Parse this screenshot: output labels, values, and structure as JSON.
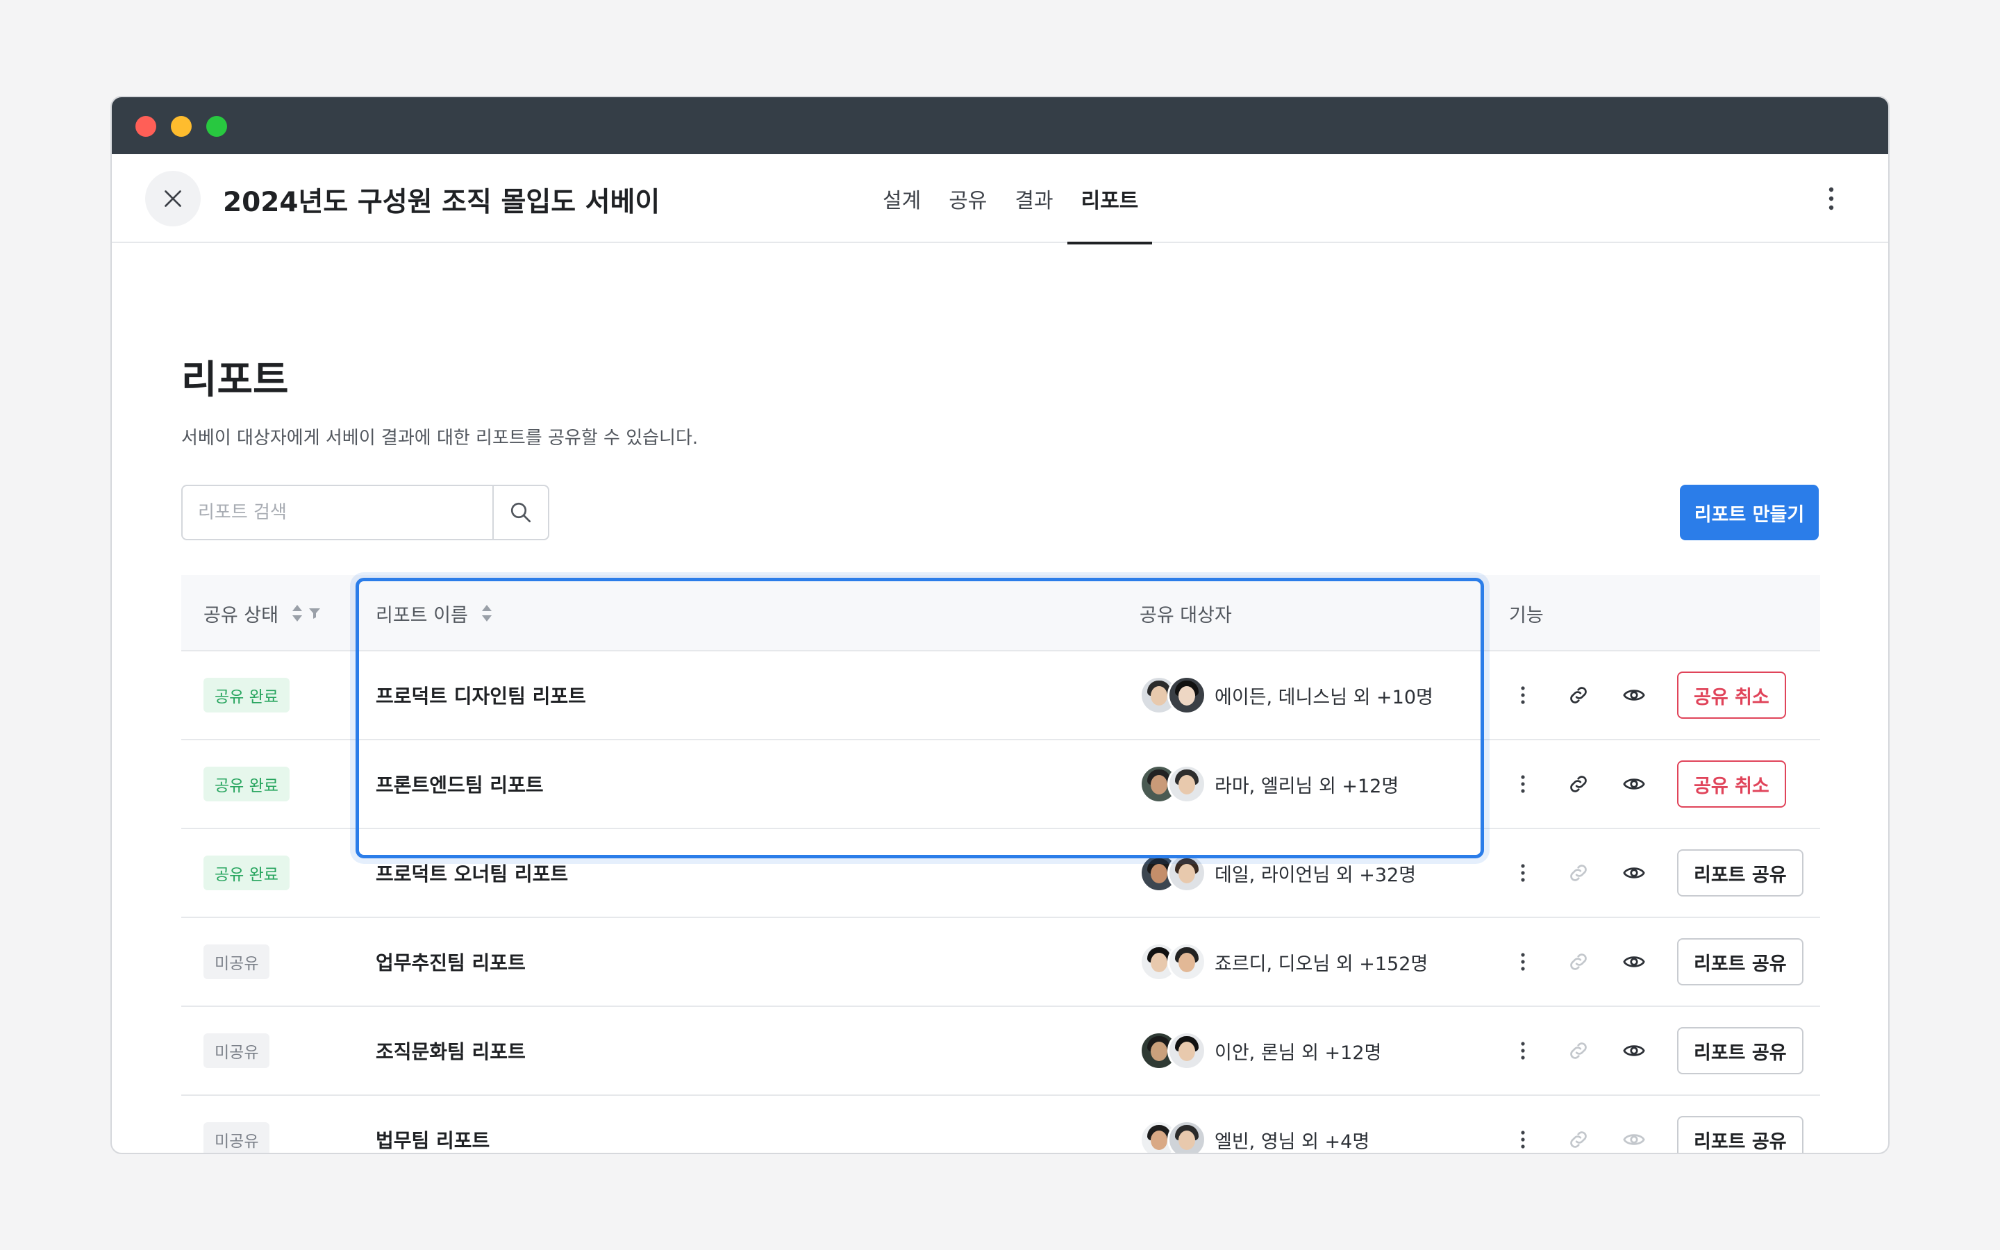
{
  "header": {
    "title": "2024년도 구성원 조직 몰입도 서베이",
    "tabs": [
      {
        "label": "설계"
      },
      {
        "label": "공유"
      },
      {
        "label": "결과"
      },
      {
        "label": "리포트",
        "active": true
      }
    ]
  },
  "page": {
    "title": "리포트",
    "description": "서베이 대상자에게 서베이 결과에 대한 리포트를 공유할 수 있습니다."
  },
  "search": {
    "placeholder": "리포트 검색",
    "value": ""
  },
  "create_button": {
    "label": "리포트 만들기"
  },
  "table": {
    "headers": {
      "status": "공유 상태",
      "name": "리포트 이름",
      "share": "공유 대상자",
      "func": "기능"
    },
    "rows": [
      {
        "status": "공유 완료",
        "status_type": "done",
        "name": "프로덕트 디자인팀 리포트",
        "share": "에이든, 데니스님 외 +10명",
        "link_enabled": true,
        "view_enabled": true,
        "action": "공유 취소",
        "action_type": "cancel"
      },
      {
        "status": "공유 완료",
        "status_type": "done",
        "name": "프론트엔드팀 리포트",
        "share": "라마, 엘리님 외 +12명",
        "link_enabled": true,
        "view_enabled": true,
        "action": "공유 취소",
        "action_type": "cancel"
      },
      {
        "status": "공유 완료",
        "status_type": "done",
        "name": "프로덕트 오너팀 리포트",
        "share": "데일, 라이언님 외 +32명",
        "link_enabled": false,
        "view_enabled": true,
        "action": "리포트 공유",
        "action_type": "share"
      },
      {
        "status": "미공유",
        "status_type": "none",
        "name": "업무추진팀 리포트",
        "share": "죠르디, 디오님 외 +152명",
        "link_enabled": false,
        "view_enabled": true,
        "action": "리포트 공유",
        "action_type": "share"
      },
      {
        "status": "미공유",
        "status_type": "none",
        "name": "조직문화팀 리포트",
        "share": "이안, 론님 외 +12명",
        "link_enabled": false,
        "view_enabled": true,
        "action": "리포트 공유",
        "action_type": "share"
      },
      {
        "status": "미공유",
        "status_type": "none",
        "name": "법무팀 리포트",
        "share": "엘빈, 영님 외 +4명",
        "link_enabled": false,
        "view_enabled": false,
        "action": "리포트 공유",
        "action_type": "share"
      }
    ]
  },
  "colors": {
    "accent": "#2b7de9",
    "titlebar": "#353e47",
    "success": "#28a55f",
    "danger": "#e0445a"
  }
}
